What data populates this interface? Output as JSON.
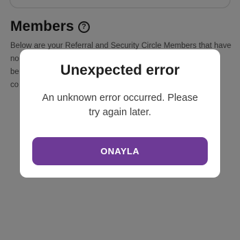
{
  "background": {
    "section_title": "Members",
    "help_icon": "question-circle-icon",
    "help_glyph": "?",
    "description": "Below are your Referral and Security Circle Members that have not yet … in … be… co…"
  },
  "dialog": {
    "title": "Unexpected error",
    "message": "An unknown error occurred. Please try again later.",
    "button_label": "ONAYLA"
  },
  "colors": {
    "accent": "#6d3a96",
    "overlay": "rgba(0,0,0,0.5)"
  }
}
